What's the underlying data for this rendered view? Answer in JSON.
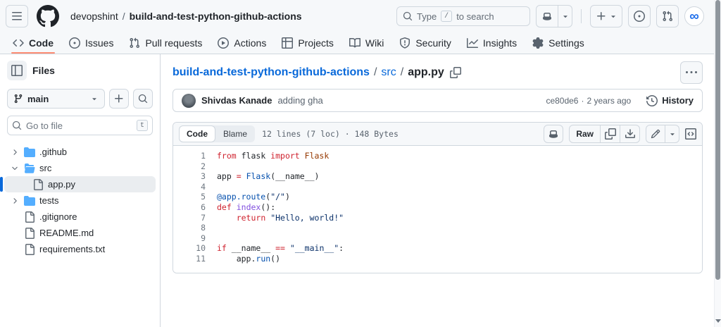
{
  "colors": {
    "accent": "#0969da",
    "tab_underline": "#fd8c73",
    "folder": "#54aeff",
    "header_bg": "#f6f8fa",
    "border": "#d0d7de"
  },
  "header": {
    "org": "devopshint",
    "sep": "/",
    "repo": "build-and-test-python-github-actions",
    "search_pre": "Type",
    "search_key": "/",
    "search_post": "to search"
  },
  "nav": {
    "tabs": [
      {
        "label": "Code",
        "active": true
      },
      {
        "label": "Issues",
        "active": false
      },
      {
        "label": "Pull requests",
        "active": false
      },
      {
        "label": "Actions",
        "active": false
      },
      {
        "label": "Projects",
        "active": false
      },
      {
        "label": "Wiki",
        "active": false
      },
      {
        "label": "Security",
        "active": false
      },
      {
        "label": "Insights",
        "active": false
      },
      {
        "label": "Settings",
        "active": false
      }
    ]
  },
  "sidebar": {
    "title": "Files",
    "branch": "main",
    "goto_placeholder": "Go to file",
    "goto_key": "t",
    "tree": [
      {
        "name": ".github",
        "kind": "folder",
        "state": "collapsed",
        "level": 0,
        "selected": false
      },
      {
        "name": "src",
        "kind": "folder",
        "state": "expanded",
        "level": 0,
        "selected": false
      },
      {
        "name": "app.py",
        "kind": "file",
        "level": 1,
        "selected": true
      },
      {
        "name": "tests",
        "kind": "folder",
        "state": "collapsed",
        "level": 0,
        "selected": false
      },
      {
        "name": ".gitignore",
        "kind": "file",
        "level": 0,
        "selected": false
      },
      {
        "name": "README.md",
        "kind": "file",
        "level": 0,
        "selected": false
      },
      {
        "name": "requirements.txt",
        "kind": "file",
        "level": 0,
        "selected": false
      }
    ]
  },
  "main": {
    "breadcrumb": {
      "repo": "build-and-test-python-github-actions",
      "sep": "/",
      "dir": "src",
      "file": "app.py"
    },
    "commit": {
      "author": "Shivdas Kanade",
      "message": "adding gha",
      "sha": "ce80de6",
      "dot": "·",
      "time": "2 years ago",
      "history": "History"
    },
    "toolbar": {
      "code_tab": "Code",
      "blame_tab": "Blame",
      "meta": "12 lines (7 loc) · 148 Bytes",
      "raw": "Raw"
    },
    "code": {
      "lines": [
        {
          "n": 1,
          "tokens": [
            [
              "k",
              "from"
            ],
            [
              "p",
              " flask "
            ],
            [
              "k",
              "import"
            ],
            [
              "c",
              " Flask"
            ]
          ]
        },
        {
          "n": 2,
          "tokens": []
        },
        {
          "n": 3,
          "tokens": [
            [
              "p",
              "app "
            ],
            [
              "k",
              "="
            ],
            [
              "p",
              " "
            ],
            [
              "e",
              "Flask"
            ],
            [
              "p",
              "(__name__)"
            ]
          ]
        },
        {
          "n": 4,
          "tokens": []
        },
        {
          "n": 5,
          "tokens": [
            [
              "e",
              "@app.route"
            ],
            [
              "p",
              "("
            ],
            [
              "s",
              "\"/\""
            ],
            [
              "p",
              ")"
            ]
          ]
        },
        {
          "n": 6,
          "tokens": [
            [
              "k",
              "def"
            ],
            [
              "p",
              " "
            ],
            [
              "f",
              "index"
            ],
            [
              "p",
              "():"
            ]
          ]
        },
        {
          "n": 7,
          "tokens": [
            [
              "p",
              "    "
            ],
            [
              "k",
              "return"
            ],
            [
              "p",
              " "
            ],
            [
              "s",
              "\"Hello, world!\""
            ]
          ]
        },
        {
          "n": 8,
          "tokens": []
        },
        {
          "n": 9,
          "tokens": []
        },
        {
          "n": 10,
          "tokens": [
            [
              "k",
              "if"
            ],
            [
              "p",
              " __name__ "
            ],
            [
              "k",
              "=="
            ],
            [
              "p",
              " "
            ],
            [
              "s",
              "\"__main__\""
            ],
            [
              "p",
              ":"
            ]
          ]
        },
        {
          "n": 11,
          "tokens": [
            [
              "p",
              "    app."
            ],
            [
              "e",
              "run"
            ],
            [
              "p",
              "()"
            ]
          ]
        }
      ]
    }
  },
  "icons": [
    "hamburger-icon",
    "github-logo-icon",
    "search-icon",
    "copilot-icon",
    "dropdown-caret-icon",
    "plus-icon",
    "issue-opened-icon",
    "pull-request-icon",
    "avatar-infinity-logo",
    "code-icon",
    "play-circle-icon",
    "table-icon",
    "book-icon",
    "shield-icon",
    "graph-icon",
    "gear-icon",
    "side-panel-icon",
    "git-branch-icon",
    "chevron-right-icon",
    "chevron-down-icon",
    "folder-icon",
    "folder-open-icon",
    "file-icon",
    "copy-icon",
    "kebab-icon",
    "history-clock-icon",
    "raw-copy-icon",
    "download-icon",
    "pencil-icon",
    "code-square-icon"
  ]
}
